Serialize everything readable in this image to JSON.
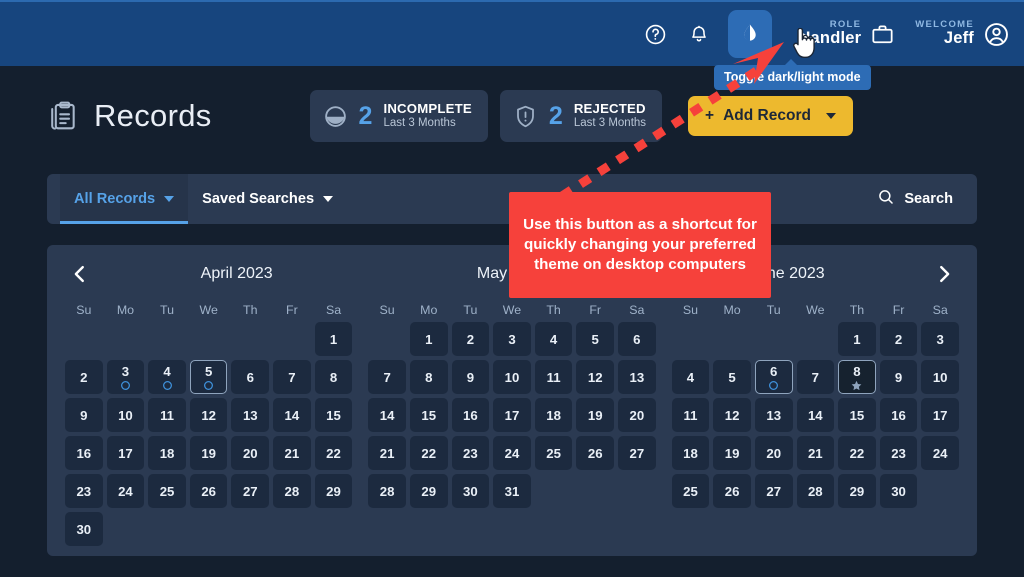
{
  "topbar": {
    "help_icon": "question-circle-icon",
    "bell_icon": "bell-icon",
    "theme_icon": "droplet-half-icon",
    "role_label": "ROLE",
    "role_value": "Handler",
    "role_icon": "briefcase-icon",
    "welcome_label": "WELCOME",
    "welcome_value": "Jeff",
    "avatar_icon": "user-circle-icon",
    "tooltip": "Toggle dark/light mode",
    "accent": "#2d6cb5",
    "bar_color": "#17457e"
  },
  "header": {
    "title": "Records",
    "title_icon": "clipboard-icon",
    "stats": [
      {
        "icon": "incomplete-circle-icon",
        "count": "2",
        "label": "INCOMPLETE",
        "sub": "Last 3 Months"
      },
      {
        "icon": "shield-exclamation-icon",
        "count": "2",
        "label": "REJECTED",
        "sub": "Last 3 Months"
      }
    ],
    "add_button": {
      "plus": "+",
      "label": "Add Record",
      "color": "#edb92e"
    }
  },
  "toolbar": {
    "tabs": [
      {
        "label": "All Records",
        "active": true
      },
      {
        "label": "Saved Searches",
        "active": false
      }
    ],
    "search_label": "Search",
    "search_icon": "magnifier-icon"
  },
  "calendar": {
    "prev_icon": "chevron-left-icon",
    "next_icon": "chevron-right-icon",
    "dow": [
      "Su",
      "Mo",
      "Tu",
      "We",
      "Th",
      "Fr",
      "Sa"
    ],
    "months": [
      {
        "title": "April 2023",
        "lead_blanks": 6,
        "days": 30,
        "markers": {
          "3": "circle",
          "4": "circle",
          "5": "half-circle"
        },
        "selected": [
          "5"
        ],
        "dark": []
      },
      {
        "title": "May 2023",
        "lead_blanks": 1,
        "days": 31,
        "markers": {},
        "selected": [],
        "dark": []
      },
      {
        "title": "June 2023",
        "lead_blanks": 4,
        "days": 30,
        "markers": {
          "6": "half-circle",
          "8": "star"
        },
        "selected": [
          "6",
          "8"
        ],
        "dark": [
          "8"
        ]
      }
    ]
  },
  "callout": {
    "text": "Use this button as a shortcut for quickly changing your preferred theme on desktop computers",
    "color": "#f6413b"
  },
  "cursor": {
    "icon": "pointer-hand-cursor"
  }
}
